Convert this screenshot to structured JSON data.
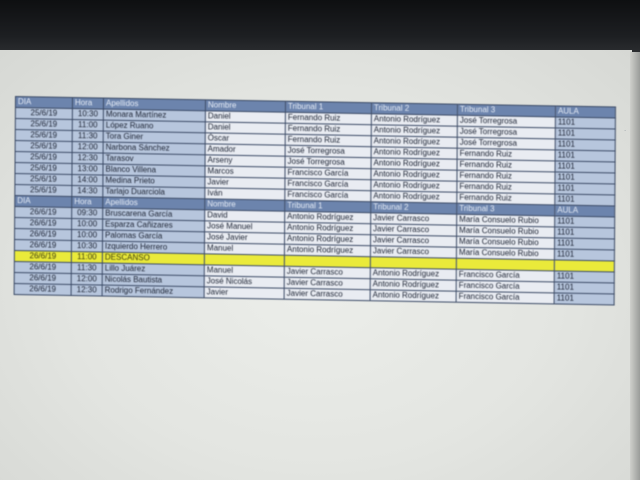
{
  "headers": [
    "DIA",
    "Hora",
    "Apellidos",
    "Nombre",
    "Tribunal 1",
    "Tribunal 2",
    "Tribunal 3",
    "AULA"
  ],
  "block1": [
    [
      "25/6/19",
      "10:30",
      "Monara Martínez",
      "Daniel",
      "Fernando Ruiz",
      "Antonio Rodríguez",
      "José Torregrosa",
      "1101"
    ],
    [
      "25/6/19",
      "11:00",
      "López Ruano",
      "Daniel",
      "Fernando Ruiz",
      "Antonio Rodríguez",
      "José Torregrosa",
      "1101"
    ],
    [
      "25/6/19",
      "11:30",
      "Tora Giner",
      "Óscar",
      "Fernando Ruiz",
      "Antonio Rodríguez",
      "José Torregrosa",
      "1101"
    ],
    [
      "25/6/19",
      "12:00",
      "Narbona Sánchez",
      "Amador",
      "José Torregrosa",
      "Antonio Rodríguez",
      "Fernando Ruiz",
      "1101"
    ],
    [
      "25/6/19",
      "12:30",
      "Tarasov",
      "Arseny",
      "José Torregrosa",
      "Antonio Rodríguez",
      "Fernando Ruiz",
      "1101"
    ],
    [
      "25/6/19",
      "13:00",
      "Blanco Villena",
      "Marcos",
      "Francisco García",
      "Antonio Rodríguez",
      "Fernando Ruiz",
      "1101"
    ],
    [
      "25/6/19",
      "14:00",
      "Medina Prieto",
      "Javier",
      "Francisco García",
      "Antonio Rodríguez",
      "Fernando Ruiz",
      "1101"
    ],
    [
      "25/6/19",
      "14:30",
      "Tarlajo Duarciola",
      "Iván",
      "Francisco García",
      "Antonio Rodríguez",
      "Fernando Ruiz",
      "1101"
    ]
  ],
  "block2": [
    [
      "26/6/19",
      "09:30",
      "Bruscarena García",
      "David",
      "Antonio Rodríguez",
      "Javier Carrasco",
      "María Consuelo Rubio",
      "1101"
    ],
    [
      "26/6/19",
      "10:00",
      "Esparza Cañizares",
      "José Manuel",
      "Antonio Rodríguez",
      "Javier Carrasco",
      "María Consuelo Rubio",
      "1101"
    ],
    [
      "26/6/19",
      "10:00",
      "Palomas García",
      "José Javier",
      "Antonio Rodríguez",
      "Javier Carrasco",
      "María Consuelo Rubio",
      "1101"
    ],
    [
      "26/6/19",
      "10:30",
      "Izquierdo Herrero",
      "Manuel",
      "Antonio Rodríguez",
      "Javier Carrasco",
      "María Consuelo Rubio",
      "1101"
    ],
    [
      "26/6/19",
      "11:00",
      "DESCANSO",
      "",
      "",
      "",
      "",
      ""
    ],
    [
      "26/6/19",
      "11:30",
      "Lillo Juárez",
      "Manuel",
      "Javier Carrasco",
      "Antonio Rodríguez",
      "Francisco García",
      "1101"
    ],
    [
      "26/6/19",
      "12:00",
      "Nicolás Bautista",
      "José Nicolás",
      "Javier Carrasco",
      "Antonio Rodríguez",
      "Francisco García",
      "1101"
    ],
    [
      "26/6/19",
      "12:30",
      "Rodrigo Fernández",
      "Javier",
      "Javier Carrasco",
      "Antonio Rodríguez",
      "Francisco García",
      "1101"
    ]
  ],
  "break_label": "DESCANSO",
  "colors": {
    "header": "#6c84ad",
    "cell": "#b7c6dd",
    "highlight": "#eaea3a",
    "screen": "#e6e8e4"
  }
}
